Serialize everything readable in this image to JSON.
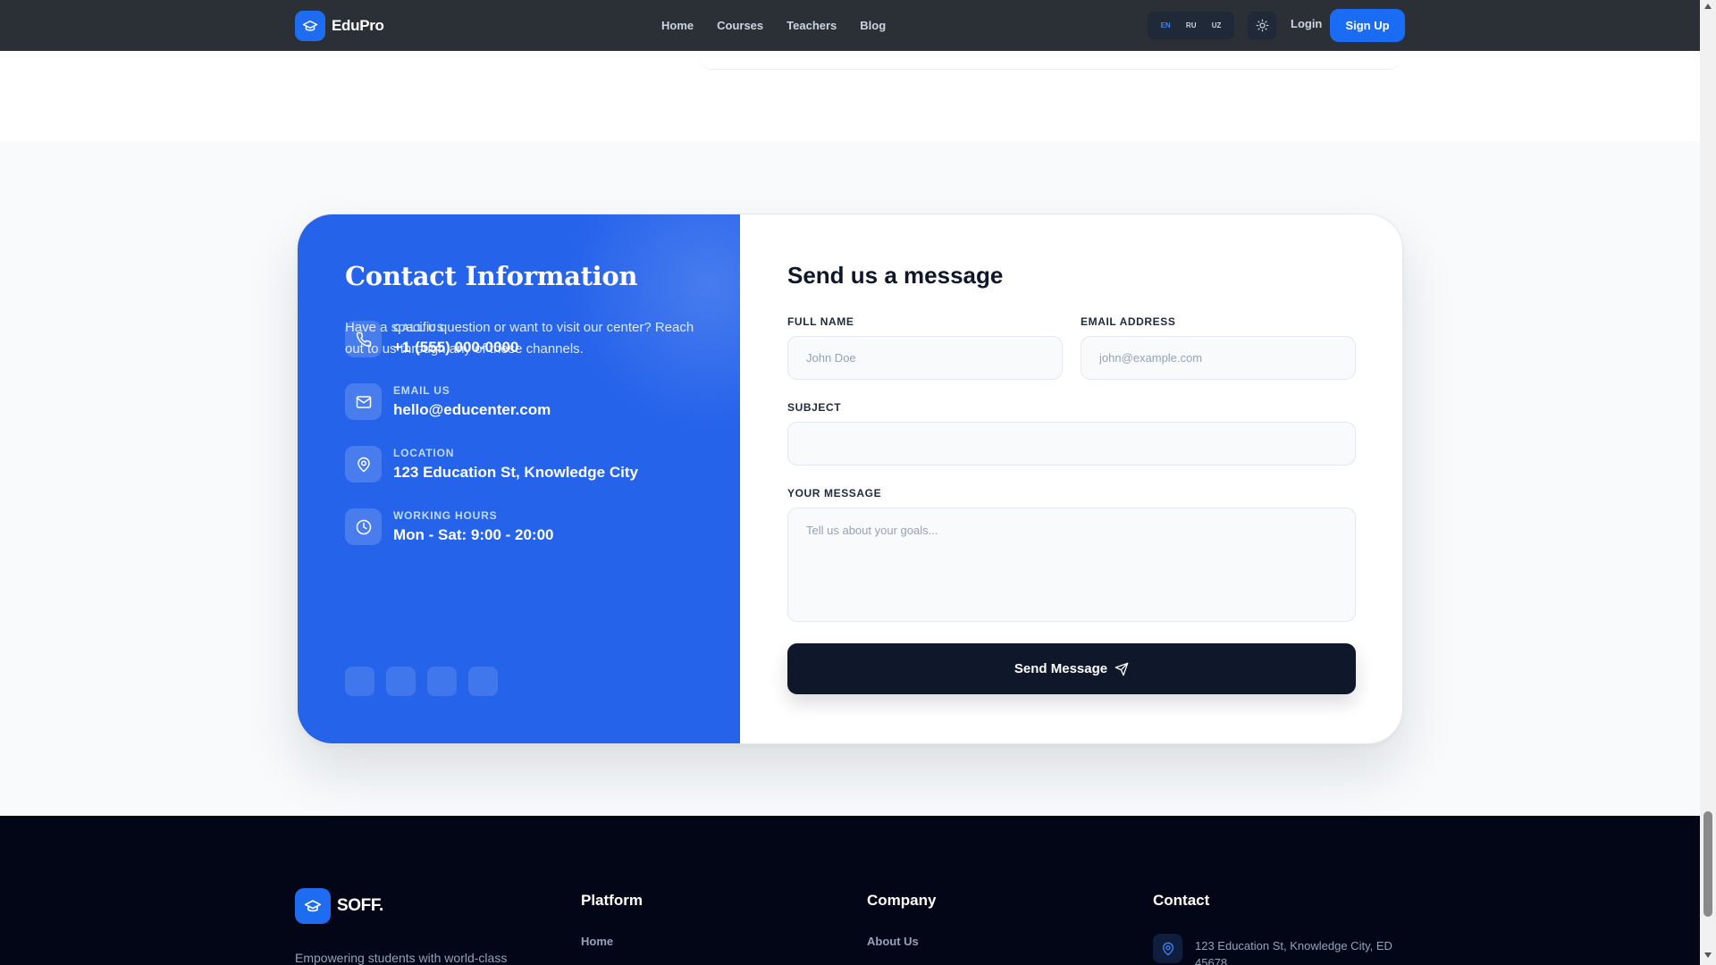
{
  "navbar": {
    "brand": "EduPro",
    "links": [
      "Home",
      "Courses",
      "Teachers",
      "Blog"
    ],
    "languages": [
      "EN",
      "RU",
      "UZ"
    ],
    "active_language": "EN",
    "login": "Login",
    "signup": "Sign Up"
  },
  "contact_info": {
    "title": "Contact Information",
    "subtitle": "Have a specific question or want to visit our center? Reach out to us through any of these channels.",
    "items": [
      {
        "label": "CALL US",
        "value": "+1 (555) 000-0000",
        "icon": "phone-icon"
      },
      {
        "label": "EMAIL US",
        "value": "hello@educenter.com",
        "icon": "mail-icon"
      },
      {
        "label": "LOCATION",
        "value": "123 Education St, Knowledge City",
        "icon": "location-pin-icon"
      },
      {
        "label": "WORKING HOURS",
        "value": "Mon - Sat: 9:00 - 20:00",
        "icon": "clock-icon"
      }
    ]
  },
  "form": {
    "title": "Send us a message",
    "full_name_label": "FULL NAME",
    "full_name_placeholder": "John Doe",
    "email_label": "EMAIL ADDRESS",
    "email_placeholder": "john@example.com",
    "subject_label": "SUBJECT",
    "subject_placeholder": "",
    "message_label": "YOUR MESSAGE",
    "message_placeholder": "Tell us about your goals...",
    "submit_label": "Send Message"
  },
  "footer": {
    "brand": "SOFF.",
    "tagline": "Empowering students with world-class",
    "columns": [
      {
        "title": "Platform",
        "first_link": "Home"
      },
      {
        "title": "Company",
        "first_link": "About Us"
      },
      {
        "title": "Contact",
        "first_link": ""
      }
    ],
    "contact_address": "123 Education St, Knowledge City, ED 45678"
  },
  "colors": {
    "accent": "#2563eb",
    "navbar_bg": "#2b2f36",
    "footer_bg": "#020617",
    "button_dark": "#0f172a"
  }
}
